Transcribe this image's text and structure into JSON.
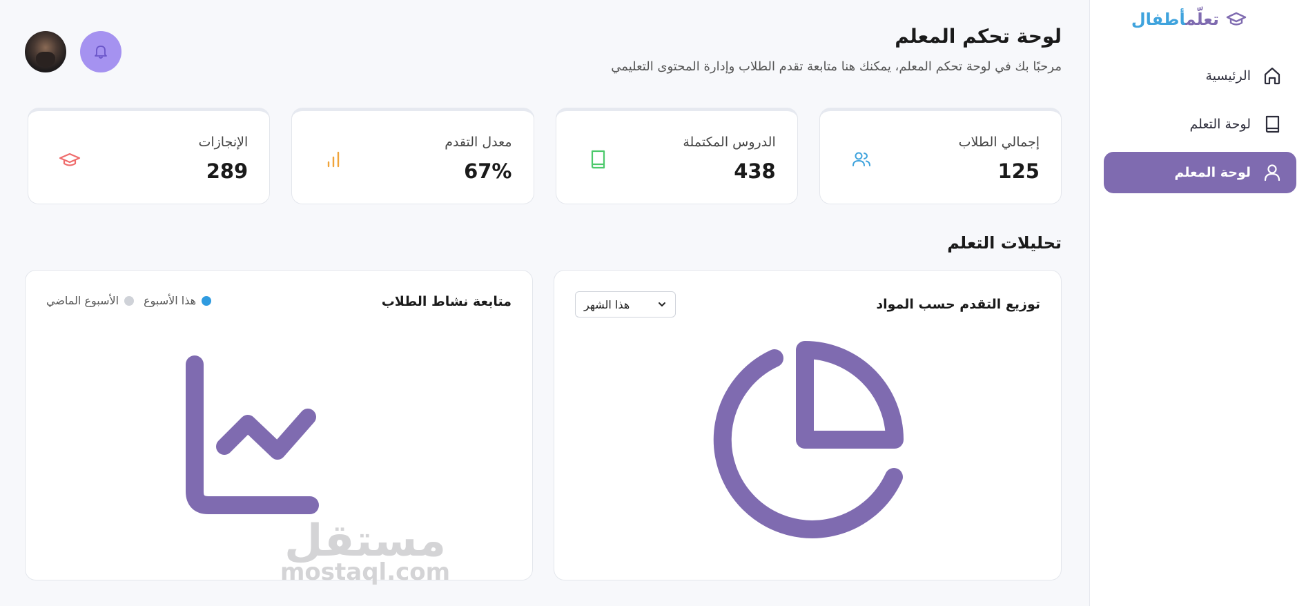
{
  "logo": {
    "part1": "تعلّم",
    "part2": "أطفال"
  },
  "sidebar": {
    "items": [
      {
        "label": "الرئيسية",
        "icon": "home-icon",
        "active": false
      },
      {
        "label": "لوحة التعلم",
        "icon": "book-icon",
        "active": false
      },
      {
        "label": "لوحة المعلم",
        "icon": "user-icon",
        "active": true
      }
    ]
  },
  "header": {
    "title": "لوحة تحكم المعلم",
    "subtitle": "مرحبًا بك في لوحة تحكم المعلم، يمكنك هنا متابعة تقدم الطلاب وإدارة المحتوى التعليمي"
  },
  "stats": [
    {
      "label": "إجمالي الطلاب",
      "value": "125",
      "icon": "users-icon",
      "color": "#3fa3dd"
    },
    {
      "label": "الدروس المكتملة",
      "value": "438",
      "icon": "book-icon",
      "color": "#4cc96b"
    },
    {
      "label": "معدل التقدم",
      "value": "67%",
      "icon": "bar-chart-icon",
      "color": "#f0a43a"
    },
    {
      "label": "الإنجازات",
      "value": "289",
      "icon": "graduation-cap-icon",
      "color": "#ef6b6b"
    }
  ],
  "analytics": {
    "section_title": "تحليلات التعلم",
    "subject_progress": {
      "title": "توزيع التقدم حسب المواد",
      "period_selected": "هذا الشهر"
    },
    "activity": {
      "title": "متابعة نشاط الطلاب",
      "legend": [
        {
          "label": "هذا الأسبوع",
          "color": "#2f9be0"
        },
        {
          "label": "الأسبوع الماضي",
          "color": "#cfd2d8"
        }
      ]
    }
  },
  "watermark": {
    "ar": "مستقل",
    "en": "mostaql.com"
  },
  "colors": {
    "accent": "#7f6bb0",
    "bell": "#a592f0"
  }
}
